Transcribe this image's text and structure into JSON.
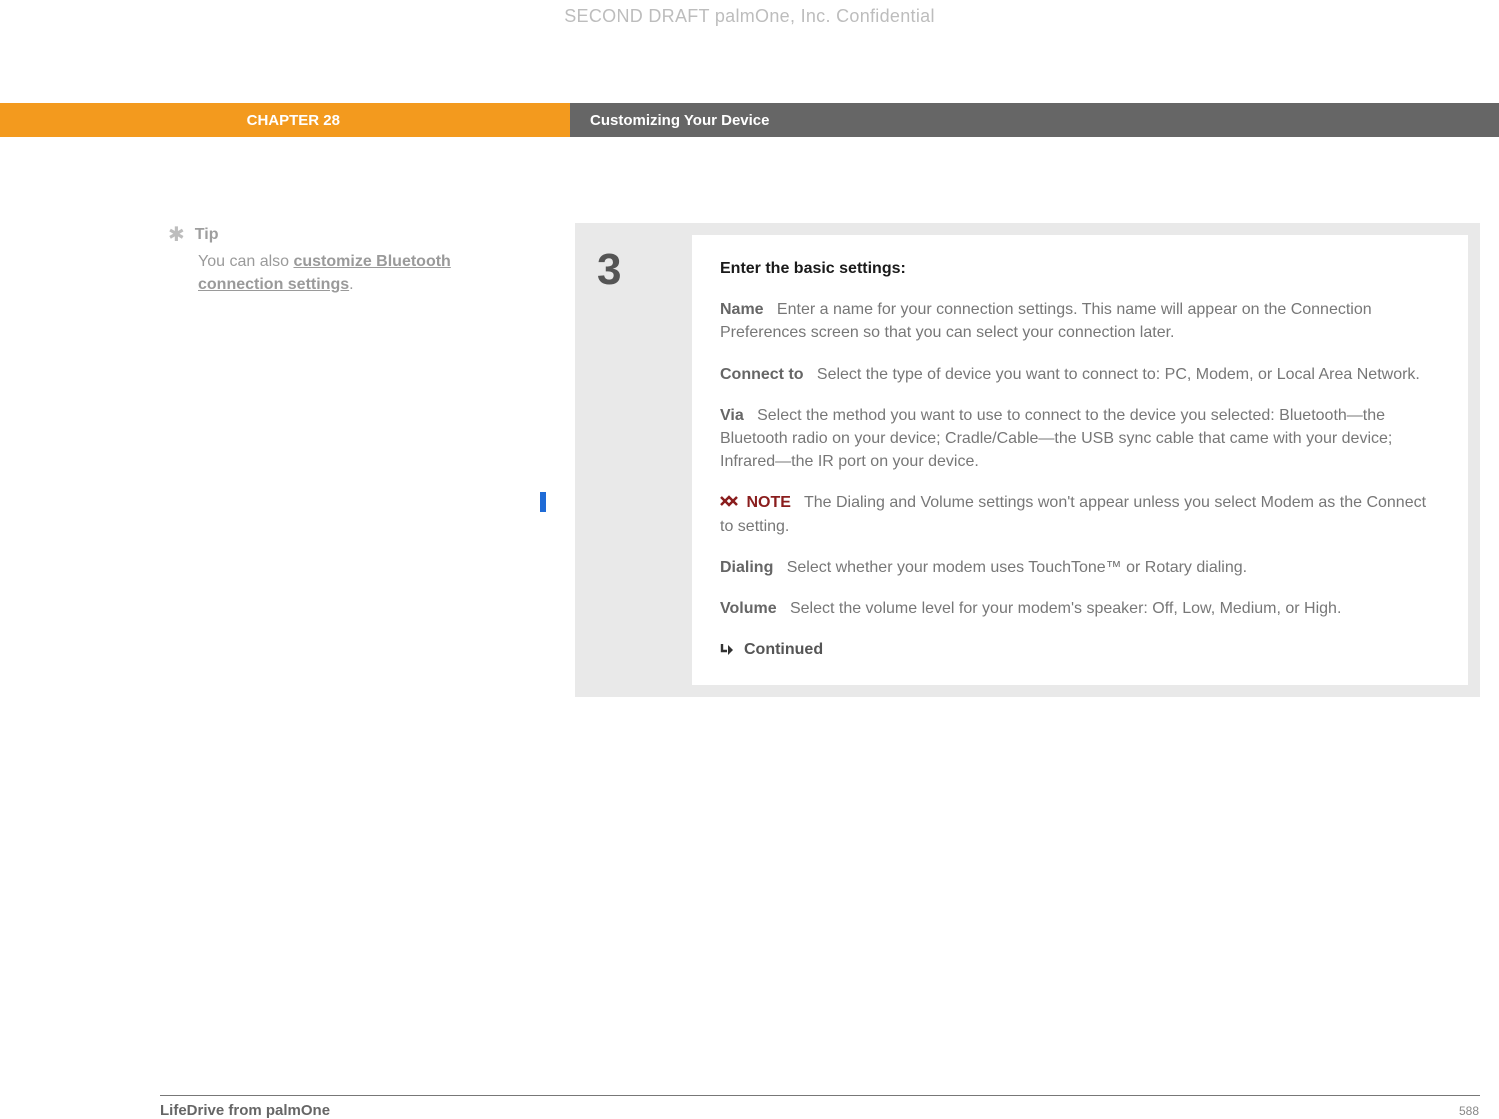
{
  "watermark": "SECOND DRAFT palmOne, Inc.  Confidential",
  "header": {
    "chapter": "CHAPTER 28",
    "title": "Customizing Your Device"
  },
  "sidebar": {
    "tip_label": "Tip",
    "tip_prefix": "You can also ",
    "tip_link": "customize Bluetooth connection settings",
    "tip_suffix": "."
  },
  "step": {
    "number": "3",
    "heading": "Enter the basic settings:",
    "items": {
      "name_term": "Name",
      "name_desc": "Enter a name for your connection settings. This name will appear on the Connection Preferences screen so that you can select your connection later.",
      "connect_term": "Connect to",
      "connect_desc": "Select the type of device you want to connect to: PC, Modem, or Local Area Network.",
      "via_term": "Via",
      "via_desc": "Select the method you want to use to connect to the device you selected: Bluetooth—the Bluetooth radio on your device; Cradle/Cable—the USB sync cable that came with your device; Infrared—the IR port on your device.",
      "note_label": "NOTE",
      "note_desc": "The Dialing and Volume settings won't appear unless you select Modem as the Connect to setting.",
      "dialing_term": "Dialing",
      "dialing_desc": "Select whether your modem uses TouchTone™ or Rotary dialing.",
      "volume_term": "Volume",
      "volume_desc": "Select the volume level for your modem's speaker: Off, Low, Medium, or High."
    },
    "continued": "Continued"
  },
  "footer": {
    "product": "LifeDrive from palmOne",
    "page": "588"
  }
}
